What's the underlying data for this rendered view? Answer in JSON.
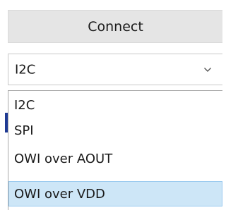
{
  "connect_button": {
    "label": "Connect"
  },
  "protocol_select": {
    "selected_value": "I2C",
    "chevron_icon": "chevron-down-icon",
    "options": [
      {
        "label": "I2C"
      },
      {
        "label": "SPI"
      },
      {
        "label": "OWI over AOUT"
      },
      {
        "label": "OWI over VDD"
      }
    ],
    "highlighted_option": "OWI over VDD"
  },
  "colors": {
    "button_bg": "#e5e5e5",
    "highlight_bg": "#cde6f7",
    "highlight_border": "#99c9ef",
    "marker": "#1f3a93"
  }
}
